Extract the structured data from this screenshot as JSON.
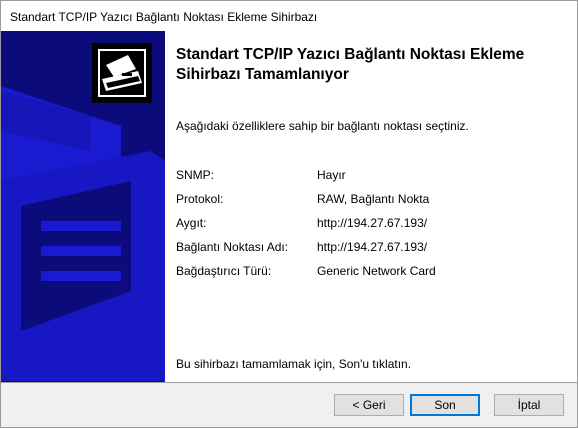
{
  "window": {
    "title": "Standart TCP/IP Yazıcı Bağlantı Noktası Ekleme Sihirbazı"
  },
  "content": {
    "heading": "Standart TCP/IP Yazıcı Bağlantı Noktası Ekleme Sihirbazı Tamamlanıyor",
    "intro": "Aşağıdaki özelliklere sahip bir bağlantı noktası seçtiniz.",
    "properties": [
      {
        "label": "SNMP:",
        "value": "Hayır"
      },
      {
        "label": "Protokol:",
        "value": "RAW, Bağlantı Nokta"
      },
      {
        "label": "Aygıt:",
        "value": "http://194.27.67.193/"
      },
      {
        "label": "Bağlantı Noktası Adı:",
        "value": "http://194.27.67.193/"
      },
      {
        "label": "Bağdaştırıcı Türü:",
        "value": "Generic Network Card"
      }
    ],
    "finish_note": "Bu sihirbazı tamamlamak için, Son'u tıklatın."
  },
  "buttons": {
    "back": "< Geri",
    "finish": "Son",
    "cancel": "İptal"
  },
  "colors": {
    "banner": "#0b0b7c",
    "banner_shapes": "#1a1ad0",
    "focus_border": "#0078d7"
  }
}
